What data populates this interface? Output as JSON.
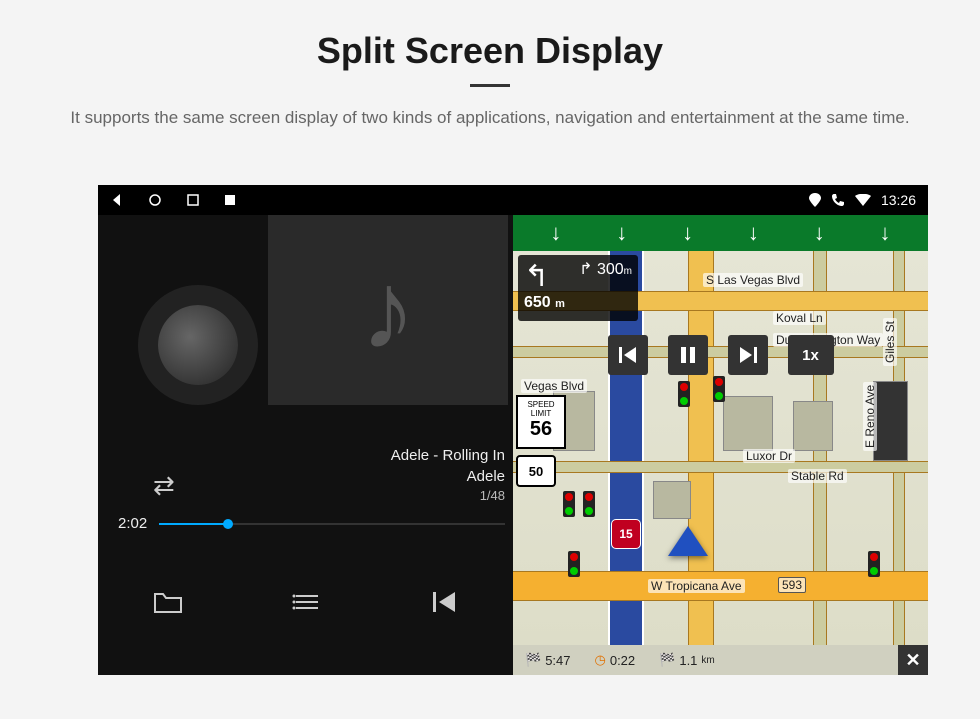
{
  "header": {
    "title": "Split Screen Display",
    "subtitle": "It supports the same screen display of two kinds of applications, navigation and entertainment at the same time."
  },
  "statusbar": {
    "time": "13:26"
  },
  "music": {
    "track_line1": "Adele - Rolling In",
    "track_line2": "Adele",
    "track_index": "1/48",
    "elapsed": "2:02"
  },
  "nav": {
    "turn_next_dist": "300",
    "turn_next_unit": "m",
    "turn_main_dist": "650",
    "turn_main_unit": "m",
    "speed_limit_label": "SPEED LIMIT",
    "speed_limit_value": "56",
    "route_shield": "50",
    "interstate": "15",
    "speed_multiplier": "1x",
    "roads": {
      "s_las_vegas": "S Las Vegas Blvd",
      "koval": "Koval Ln",
      "duke": "Duke Ellington Way",
      "luxor": "Luxor Dr",
      "stable": "Stable Rd",
      "reno": "E Reno Ave",
      "tropicana": "W Tropicana Ave",
      "tropicana_num": "593",
      "vegas_blvd": "Vegas Blvd",
      "giles": "Giles St"
    },
    "status": {
      "eta": "5:47",
      "remaining_time": "0:22",
      "remaining_dist": "1.1",
      "remaining_dist_unit": "km"
    }
  }
}
